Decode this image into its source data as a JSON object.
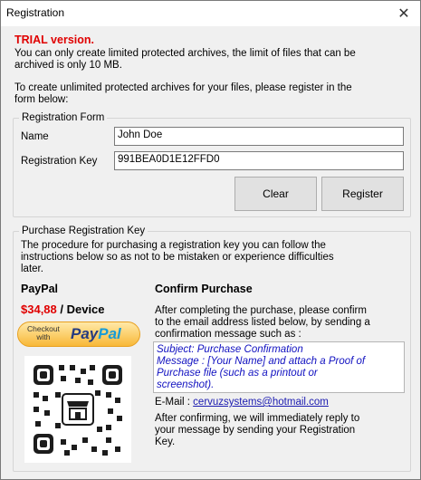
{
  "window": {
    "title": "Registration",
    "close_glyph": "✕"
  },
  "trial": {
    "heading": "TRIAL version.",
    "line1": "You can only create limited protected archives, the limit of files that can be",
    "line2": "archived is only 10 MB.",
    "line3": "To create unlimited protected archives for your files, please register in the",
    "line4": "form below:"
  },
  "registration_form": {
    "legend": "Registration Form",
    "name_label": "Name",
    "name_value": "John Doe",
    "key_label": "Registration Key",
    "key_value": "991BEA0D1E12FFD0",
    "clear_label": "Clear",
    "register_label": "Register"
  },
  "purchase": {
    "legend": "Purchase Registration Key",
    "intro1": "The procedure for purchasing a registration key you can follow the",
    "intro2": "instructions below so as not to be mistaken or experience difficulties",
    "intro3": "later.",
    "paypal_heading": "PayPal",
    "price": "$34,88",
    "price_suffix": " / Device",
    "paypal_button_small1": "Checkout",
    "paypal_button_small2": "with",
    "paypal_logo_part1": "Pay",
    "paypal_logo_part2": "Pal",
    "confirm_heading": "Confirm Purchase",
    "confirm1": "After completing the purchase, please confirm",
    "confirm2": "to the email address listed below, by sending a",
    "confirm3": "confirmation message such as :",
    "message_line1": "Subject: Purchase Confirmation",
    "message_line2": "Message : [Your Name] and attach a Proof of",
    "message_line3": "Purchase file (such as a printout or",
    "message_line4": "screenshot).",
    "email_label": "E-Mail : ",
    "email_value": "cervuzsystems@hotmail.com",
    "after1": "After confirming, we will immediately reply to",
    "after2": "your message by sending your Registration",
    "after3": "Key."
  },
  "colors": {
    "accent_red": "#e00000",
    "link_blue": "#1a1ab0",
    "message_blue": "#1010c0"
  },
  "icons": {
    "close": "close-icon",
    "qr": "qr-code-icon"
  }
}
